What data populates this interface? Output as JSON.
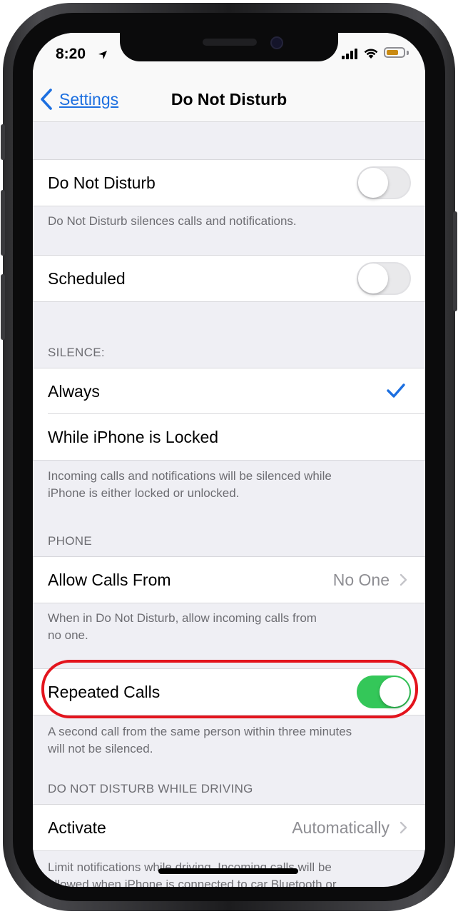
{
  "status_bar": {
    "time": "8:20",
    "location_icon": "location-arrow-icon",
    "battery_color": "#c98a12"
  },
  "nav": {
    "back_label": "Settings",
    "title": "Do Not Disturb"
  },
  "dnd": {
    "label": "Do Not Disturb",
    "toggle_on": false,
    "footer": "Do Not Disturb silences calls and notifications."
  },
  "scheduled": {
    "label": "Scheduled",
    "toggle_on": false
  },
  "silence": {
    "header": "SILENCE:",
    "options": [
      {
        "label": "Always",
        "selected": true
      },
      {
        "label": "While iPhone is Locked",
        "selected": false
      }
    ],
    "footer_line1": "Incoming calls and notifications will be silenced while",
    "footer_line2": "iPhone is either locked or unlocked."
  },
  "phone": {
    "header": "PHONE",
    "allow_calls_label": "Allow Calls From",
    "allow_calls_value": "No One",
    "footer_line1": "When in Do Not Disturb, allow incoming calls from",
    "footer_line2": "no one."
  },
  "repeated_calls": {
    "label": "Repeated Calls",
    "toggle_on": true,
    "footer_line1": "A second call from the same person within three minutes",
    "footer_line2": "will not be silenced."
  },
  "driving": {
    "header": "DO NOT DISTURB WHILE DRIVING",
    "activate_label": "Activate",
    "activate_value": "Automatically",
    "footer_line1": "Limit notifications while driving. Incoming calls will be",
    "footer_line2": "allowed when iPhone is connected to car Bluetooth or"
  },
  "colors": {
    "accent": "#1c6fe0",
    "toggle_on": "#34c759",
    "highlight": "#e3141d"
  }
}
